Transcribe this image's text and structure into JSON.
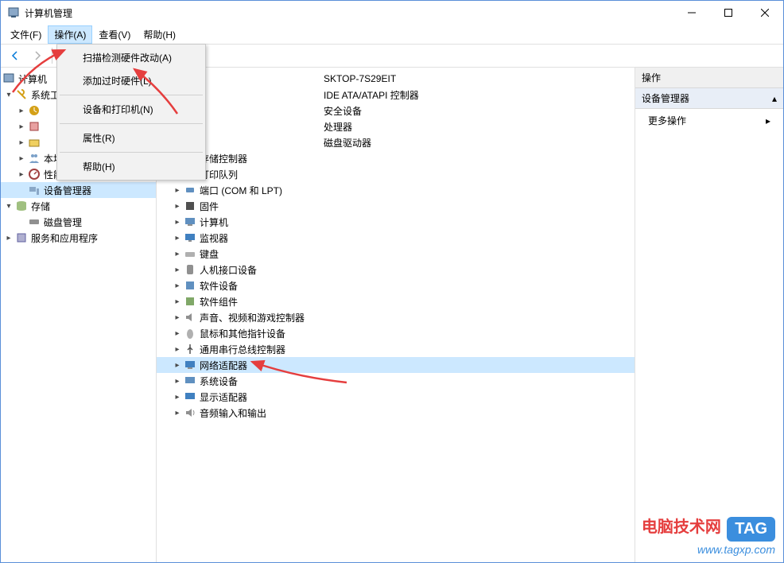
{
  "window": {
    "title": "计算机管理"
  },
  "menubar": {
    "file": "文件(F)",
    "action": "操作(A)",
    "view": "查看(V)",
    "help": "帮助(H)"
  },
  "dropdown": {
    "scan": "扫描检测硬件改动(A)",
    "add_legacy": "添加过时硬件(L)",
    "devices_printers": "设备和打印机(N)",
    "properties": "属性(R)",
    "help": "帮助(H)"
  },
  "left_tree": {
    "root": "计算机管理(本地)",
    "sys_cut": "系统工具",
    "local_users": "本地用户和组",
    "performance": "性能",
    "device_manager": "设备管理器",
    "storage": "存储",
    "disk_mgmt": "磁盘管理",
    "services": "服务和应用程序"
  },
  "device_tree": {
    "root_suffix": "SKTOP-7S29EIT",
    "ide": "IDE ATA/ATAPI 控制器",
    "security": "安全设备",
    "processors": "处理器",
    "disk_drives": "磁盘驱动器",
    "storage_ctrl": "存储控制器",
    "print_queue": "打印队列",
    "ports": "端口 (COM 和 LPT)",
    "firmware": "固件",
    "computer": "计算机",
    "monitors": "监视器",
    "keyboards": "键盘",
    "hid": "人机接口设备",
    "software_dev": "软件设备",
    "software_comp": "软件组件",
    "sound": "声音、视频和游戏控制器",
    "mice": "鼠标和其他指针设备",
    "usb": "通用串行总线控制器",
    "network": "网络适配器",
    "system_dev": "系统设备",
    "display": "显示适配器",
    "audio_io": "音频输入和输出"
  },
  "actions_pane": {
    "header": "操作",
    "section": "设备管理器",
    "more": "更多操作"
  },
  "watermark": {
    "text": "电脑技术网",
    "tag": "TAG",
    "url": "www.tagxp.com"
  }
}
